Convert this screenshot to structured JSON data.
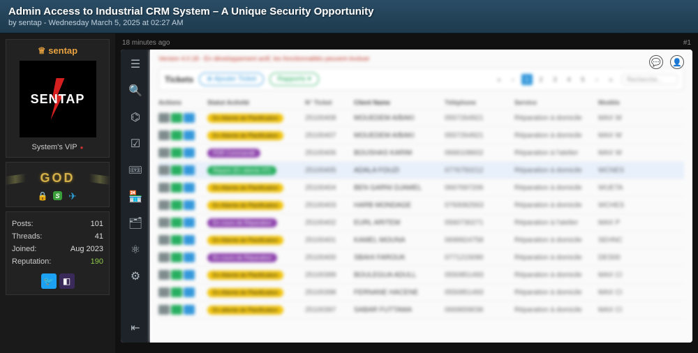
{
  "header": {
    "title": "Admin Access to Industrial CRM System – A Unique Security Opportunity",
    "byline": "by sentap - Wednesday March 5, 2025 at 02:27 AM"
  },
  "meta": {
    "age": "18 minutes ago",
    "postnum": "#1"
  },
  "user": {
    "crown_name": "sentap",
    "logo_text": "SENTAP",
    "vip_label": "System's VIP",
    "god_badge": "GOD",
    "stats": {
      "posts_label": "Posts:",
      "posts_value": "101",
      "threads_label": "Threads:",
      "threads_value": "41",
      "joined_label": "Joined:",
      "joined_value": "Aug 2023",
      "rep_label": "Reputation:",
      "rep_value": "190"
    }
  },
  "crm": {
    "warning": "Version 4.0.18 - En développement actif, les fonctionnalités peuvent évoluer",
    "toolbar": {
      "title": "Tickets",
      "add_btn": "⊕ Ajouter Ticket",
      "report_btn": "Rapports ▾",
      "search_placeholder": "Recherche..."
    },
    "pager": [
      "«",
      "‹",
      "1",
      "2",
      "3",
      "4",
      "5",
      "›",
      "»"
    ],
    "columns": {
      "actions": "Actions",
      "status": "Statut Activité",
      "ticket": "N° Ticket",
      "client": "Client Name",
      "phone": "Téléphone",
      "service": "Service",
      "model": "Modèle"
    },
    "rows": [
      {
        "status": "En Attente de Planification",
        "pill": "sp-yellow",
        "ticket": "25100408",
        "name": "MOUEDEM A/BAKI",
        "phone": "0557264921",
        "service": "Réparation à domicile",
        "model": "MAX W"
      },
      {
        "status": "En Attente de Planification",
        "pill": "sp-yellow",
        "ticket": "25100407",
        "name": "MOUEDEM A/BAKI",
        "phone": "0557264921",
        "service": "Réparation à domicile",
        "model": "MAX W"
      },
      {
        "status": "PDR Commandé",
        "pill": "sp-purple",
        "ticket": "25100406",
        "name": "BOUSHAS KARIM",
        "phone": "0666108602",
        "service": "Réparation à l'atelier",
        "model": "MAX W"
      },
      {
        "status": "Réparé (En attente HT)",
        "pill": "sp-green",
        "ticket": "25100405",
        "name": "ADALA FOUZI",
        "phone": "0776750212",
        "service": "Réparation à domicile",
        "model": "WCNES",
        "hl": true
      },
      {
        "status": "En Attente de Planification",
        "pill": "sp-yellow",
        "ticket": "25100404",
        "name": "BEN GARNI DJAMEL",
        "phone": "0667697206",
        "service": "Réparation à domicile",
        "model": "WUETA"
      },
      {
        "status": "En Attente de Planification",
        "pill": "sp-yellow",
        "ticket": "25100403",
        "name": "HARB MONDAGE",
        "phone": "0793082563",
        "service": "Réparation à domicile",
        "model": "WCHES"
      },
      {
        "status": "En cours de Réparation",
        "pill": "sp-purple",
        "ticket": "25100402",
        "name": "EURL ARITEM",
        "phone": "0560730271",
        "service": "Réparation à l'atelier",
        "model": "MAX P"
      },
      {
        "status": "En Attente de Planification",
        "pill": "sp-yellow",
        "ticket": "25100401",
        "name": "KAMEL MOUNA",
        "phone": "0699924758",
        "service": "Réparation à domicile",
        "model": "SEHNC"
      },
      {
        "status": "En cours de Réparation",
        "pill": "sp-purple",
        "ticket": "25100400",
        "name": "SBAHI FAROUK",
        "phone": "0771215090",
        "service": "Réparation à domicile",
        "model": "DES00"
      },
      {
        "status": "En Attente de Planification",
        "pill": "sp-yellow",
        "ticket": "25100399",
        "name": "BOULEGUA ADULL",
        "phone": "0550851493",
        "service": "Réparation à domicile",
        "model": "MAX CI"
      },
      {
        "status": "En Attente de Planification",
        "pill": "sp-yellow",
        "ticket": "25100398",
        "name": "FERNANE HACENE",
        "phone": "0550851493",
        "service": "Réparation à domicile",
        "model": "MAX CI"
      },
      {
        "status": "En attente de Planification",
        "pill": "sp-yellow",
        "ticket": "25100397",
        "name": "SABAR FUTTAMA",
        "phone": "0669659036",
        "service": "Réparation à domicile",
        "model": "MAX CI"
      }
    ]
  }
}
